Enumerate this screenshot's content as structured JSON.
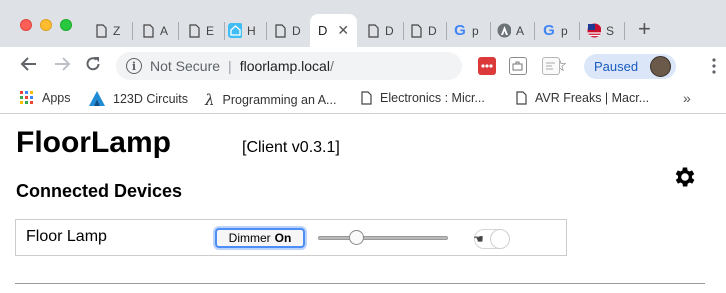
{
  "tabs": [
    {
      "icon": "page-icon",
      "title": "Z"
    },
    {
      "icon": "page-icon",
      "title": "A"
    },
    {
      "icon": "page-icon",
      "title": "E"
    },
    {
      "icon": "home-assistant-icon",
      "title": "H"
    },
    {
      "icon": "page-icon",
      "title": "D"
    },
    {
      "icon": "page-icon",
      "title": "D",
      "active": true
    },
    {
      "icon": "page-icon",
      "title": "D"
    },
    {
      "icon": "page-icon",
      "title": "D"
    },
    {
      "icon": "google-icon",
      "title": "p"
    },
    {
      "icon": "arduino-icon",
      "title": "A"
    },
    {
      "icon": "google-icon",
      "title": "p"
    },
    {
      "icon": "flag-icon",
      "title": "S"
    }
  ],
  "toolbar": {
    "security_label": "Not Secure",
    "url_host": "floorlamp.local",
    "url_path": "/",
    "paused_label": "Paused"
  },
  "bookmarks": [
    {
      "icon": "apps-grid-icon",
      "label": "Apps"
    },
    {
      "icon": "123d-circuits-icon",
      "label": "123D Circuits"
    },
    {
      "icon": "lambda-icon",
      "label": "Programming an A..."
    },
    {
      "icon": "page-icon",
      "label": "Electronics : Micr..."
    },
    {
      "icon": "page-icon",
      "label": "AVR Freaks | Macr..."
    }
  ],
  "page": {
    "brand": "FloorLamp",
    "version": "[Client v0.3.1]",
    "section_title": "Connected Devices",
    "devices": [
      {
        "name": "Floor Lamp",
        "dimmer_label": "Dimmer",
        "dimmer_state": "On",
        "brightness_fraction": 0.27,
        "power_on": false
      }
    ]
  },
  "colors": {
    "accent": "#4c8df6",
    "paused_bg": "#dbe7f9",
    "paused_text": "#1a5bbf",
    "tabstrip_bg": "#dee1e6"
  }
}
